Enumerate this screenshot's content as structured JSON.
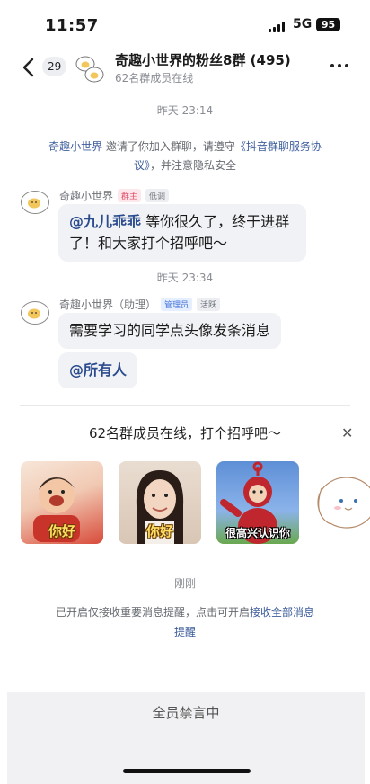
{
  "status_bar": {
    "time": "11:57",
    "network": "5G",
    "battery": "95"
  },
  "header": {
    "unread_count": "29",
    "title": "奇趣小世界的粉丝8群 (495)",
    "subtitle": "62名群成员在线"
  },
  "chat": {
    "time_1": "昨天 23:14",
    "system_notice": {
      "inviter": "奇趣小世界",
      "middle": " 邀请了你加入群聊，请遵守",
      "agreement": "《抖音群聊服务协议》",
      "end": "，并注意隐私安全"
    },
    "message_1": {
      "sender": "奇趣小世界",
      "tag_1": "群主",
      "tag_2": "低调",
      "mention": "@九儿乖乖",
      "text": " 等你很久了，终于进群了！和大家打个招呼吧～"
    },
    "time_2": "昨天 23:34",
    "message_2": {
      "sender": "奇趣小世界（助理）",
      "tag_1": "管理员",
      "tag_2": "活跃",
      "text": "需要学习的同学点头像发条消息",
      "mention_all": "@所有人"
    }
  },
  "greeting": {
    "title": "62名群成员在线，打个招呼吧～",
    "stickers": [
      {
        "caption": "你好"
      },
      {
        "caption": "你好"
      },
      {
        "caption": "很高兴认识你"
      },
      {
        "caption": ""
      }
    ]
  },
  "notification": {
    "time": "刚刚",
    "text": "已开启仅接收重要消息提醒，点击可开启",
    "link": "接收全部消息提醒"
  },
  "footer": {
    "mute_text": "全员禁言中"
  }
}
